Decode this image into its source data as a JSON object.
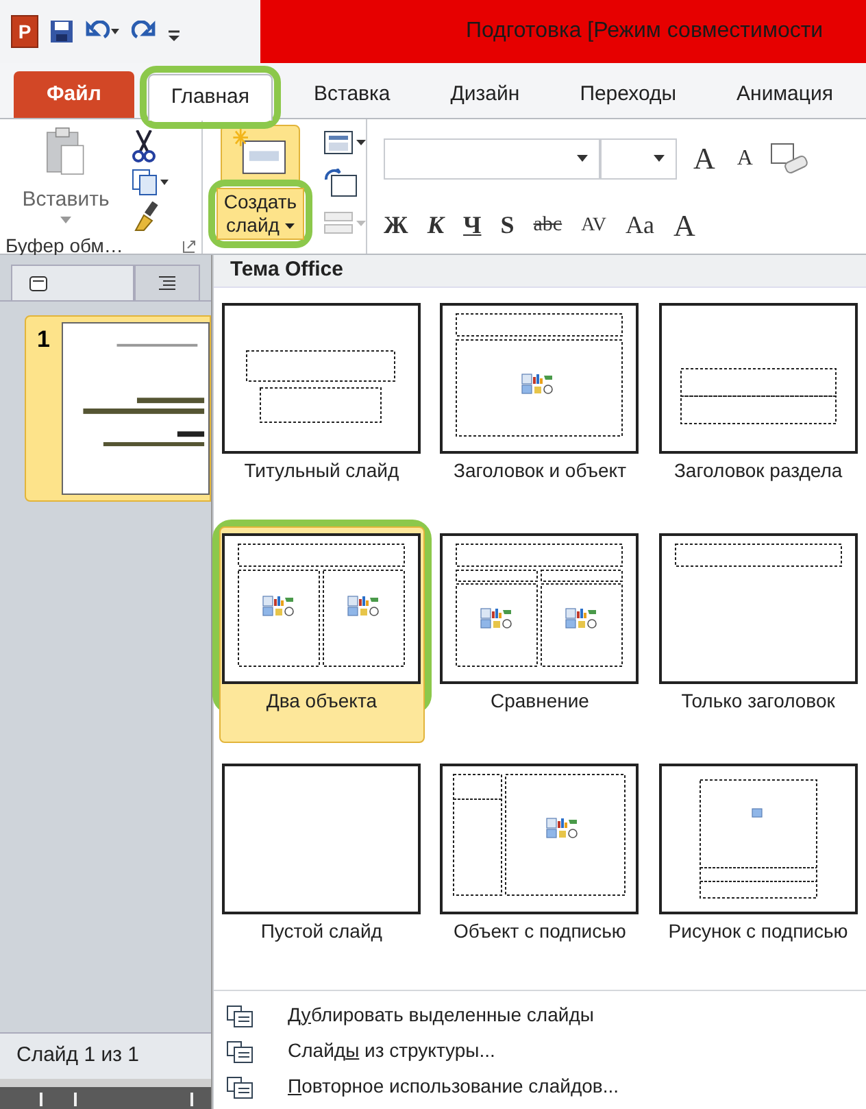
{
  "quick_access": {
    "app_letter": "P"
  },
  "window": {
    "title": "Подготовка [Режим совместимости"
  },
  "tabs": [
    {
      "label": "Файл",
      "kind": "file",
      "selected": false,
      "highlighted": false
    },
    {
      "label": "Главная",
      "kind": "tab",
      "selected": true,
      "highlighted": true
    },
    {
      "label": "Вставка",
      "kind": "tab",
      "selected": false,
      "highlighted": false
    },
    {
      "label": "Дизайн",
      "kind": "tab",
      "selected": false,
      "highlighted": false
    },
    {
      "label": "Переходы",
      "kind": "tab",
      "selected": false,
      "highlighted": false
    },
    {
      "label": "Анимация",
      "kind": "tab",
      "selected": false,
      "highlighted": false
    }
  ],
  "ribbon": {
    "paste_label": "Вставить",
    "clipboard_group": "Буфер обм…",
    "new_slide": {
      "line1": "Создать",
      "line2": "слайд",
      "highlighted": true
    },
    "grow_font": "A",
    "shrink_font": "A",
    "format_buttons": [
      "Ж",
      "К",
      "Ч",
      "S",
      "abc",
      "AV",
      "Aa",
      "A"
    ]
  },
  "slides_panel": {
    "slides": [
      {
        "number": "1",
        "selected": true
      }
    ],
    "status": "Слайд 1 из 1"
  },
  "gallery": {
    "header": "Тема Office",
    "layouts": [
      {
        "label": "Титульный слайд",
        "kind": "title",
        "selected": false,
        "highlighted": false
      },
      {
        "label": "Заголовок и объект",
        "kind": "title-content",
        "selected": false,
        "highlighted": false
      },
      {
        "label": "Заголовок раздела",
        "kind": "section",
        "selected": false,
        "highlighted": false
      },
      {
        "label": "Два объекта",
        "kind": "two-content",
        "selected": true,
        "highlighted": true
      },
      {
        "label": "Сравнение",
        "kind": "comparison",
        "selected": false,
        "highlighted": false
      },
      {
        "label": "Только заголовок",
        "kind": "title-only",
        "selected": false,
        "highlighted": false
      },
      {
        "label": "Пустой слайд",
        "kind": "blank",
        "selected": false,
        "highlighted": false
      },
      {
        "label": "Объект с подписью",
        "kind": "content-caption",
        "selected": false,
        "highlighted": false
      },
      {
        "label": "Рисунок с подписью",
        "kind": "picture-caption",
        "selected": false,
        "highlighted": false
      }
    ]
  },
  "menu": [
    {
      "before": "Д",
      "key": "у",
      "after": "блировать выделенные слайды"
    },
    {
      "before": "Слайд",
      "key": "ы",
      "after": " из структуры..."
    },
    {
      "key": "П",
      "after": "овторное использование слайдов..."
    }
  ]
}
